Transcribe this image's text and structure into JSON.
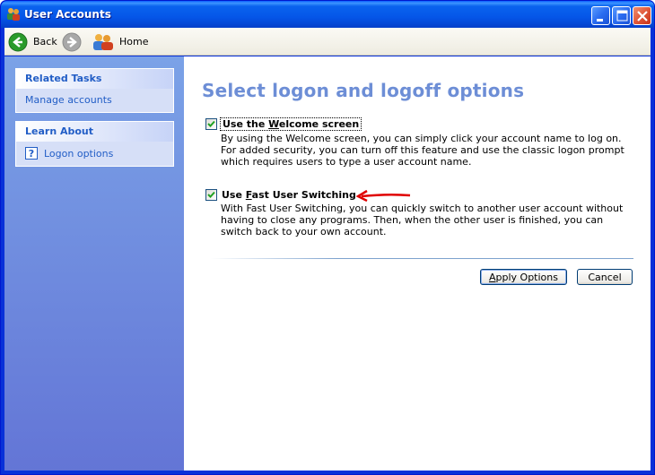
{
  "window": {
    "title": "User Accounts",
    "controls": {
      "minimize": "minimize",
      "maximize": "maximize",
      "close": "close"
    }
  },
  "toolbar": {
    "back_label": "Back",
    "forward_label": "",
    "home_label": "Home"
  },
  "sidebar": {
    "related_tasks": {
      "heading": "Related Tasks",
      "items": [
        {
          "label": "Manage accounts"
        }
      ]
    },
    "learn_about": {
      "heading": "Learn About",
      "items": [
        {
          "label": "Logon options",
          "icon": "help-icon"
        }
      ]
    }
  },
  "main": {
    "title": "Select logon and logoff options",
    "options": [
      {
        "label_pre": "Use the ",
        "label_accel": "W",
        "label_post": "elcome screen",
        "checked": true,
        "description": "By using the Welcome screen, you can simply click your account name to log on. For added security, you can turn off this feature and use the classic logon prompt which requires users to type a user account name."
      },
      {
        "label_pre": "Use ",
        "label_accel": "F",
        "label_post": "ast User Switching",
        "checked": true,
        "description": "With Fast User Switching, you can quickly switch to another user account without having to close any programs. Then, when the other user is finished, you can switch back to your own account."
      }
    ],
    "apply_label_pre": "",
    "apply_label_accel": "A",
    "apply_label_post": "pply Options",
    "cancel_label": "Cancel",
    "annotation_color": "#e00000"
  }
}
